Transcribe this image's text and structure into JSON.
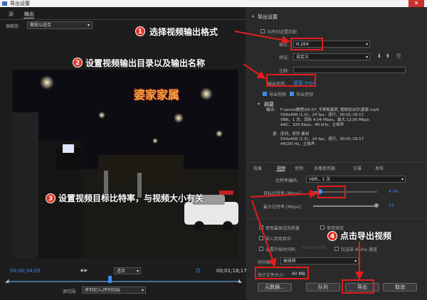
{
  "window": {
    "title": "导出设置"
  },
  "left": {
    "tabs": [
      "源",
      "输出"
    ],
    "scaling_label": "源缩放:",
    "scaling_value": "缩放以适合",
    "timecode_start": "00;00;34;05",
    "timecode_end": "00;01;18;17",
    "fit_value": "适合",
    "range_label": "源范围:",
    "range_value": "序列切入/序列切出"
  },
  "video": {
    "caption_text": "婆家家属"
  },
  "callouts": [
    {
      "number": "1",
      "text": "选择视频输出格式"
    },
    {
      "number": "2",
      "text": "设置视频输出目录以及输出名称"
    },
    {
      "number": "3",
      "text": "设置视频目标比特率，与视频大小有关"
    },
    {
      "number": "4",
      "text": "点击导出视频"
    }
  ],
  "export_settings": {
    "section_title": "导出设置",
    "match_sequence_label": "与序列设置匹配",
    "format_label": "格式:",
    "format_value": "H.264",
    "preset_label": "预设:",
    "preset_value": "自定义",
    "comments_label": "注释:",
    "output_name_label": "输出名称:",
    "output_name_value": "婆家.mp4",
    "export_video_label": "导出视频",
    "export_audio_label": "导出音频"
  },
  "summary": {
    "title": "摘要",
    "output_label": "输出:",
    "output_lines": [
      "F:\\anne\\教程\\05-07_平移和旋转_视频加水印\\婆家.mp4",
      "594x408 (1.0)，24 fps，逐行，00:01:18:17",
      "VBR，1 次，目标 4.04 Mbps，最大 12.00 Mbps",
      "AAC，320 Kbps，48 kHz，立体声"
    ],
    "source_label": "源:",
    "source_lines": [
      "序列，序列 素材",
      "594x408 (1.0)，24 fps，逐行，00:01:18:17",
      "44100 Hz，立体声"
    ]
  },
  "tabs": [
    "效果",
    "视频",
    "音频",
    "多路复用器",
    "字幕",
    "发布"
  ],
  "bitrate": {
    "encoding_label": "比特率编码:",
    "encoding_value": "VBR，1 次",
    "target_label": "目标比特率 [Mbps]:",
    "target_value": 4.04,
    "target_display": "4.04",
    "max_label": "最大比特率 [Mbps]:",
    "max_value": 12,
    "max_display": "12",
    "slider_max": 40
  },
  "options": {
    "max_render_quality": "使用最高渲染质量",
    "use_previews": "使用预览",
    "import_project": "导入到项目中",
    "set_start_timecode": "设置开始时间码",
    "timecode_placeholder": "00;00;00;00",
    "render_alpha": "仅渲染 Alpha 通道",
    "interpolation_label": "时间插值:",
    "interpolation_value": "帧采样",
    "file_size_label": "估计文件大小:",
    "file_size_value": "40 MB"
  },
  "buttons": {
    "metadata": "元数据...",
    "queue": "队列",
    "export": "导出",
    "cancel": "取消"
  },
  "colors": {
    "accent": "#3e8ee9",
    "callout_red": "#e21d1d"
  }
}
